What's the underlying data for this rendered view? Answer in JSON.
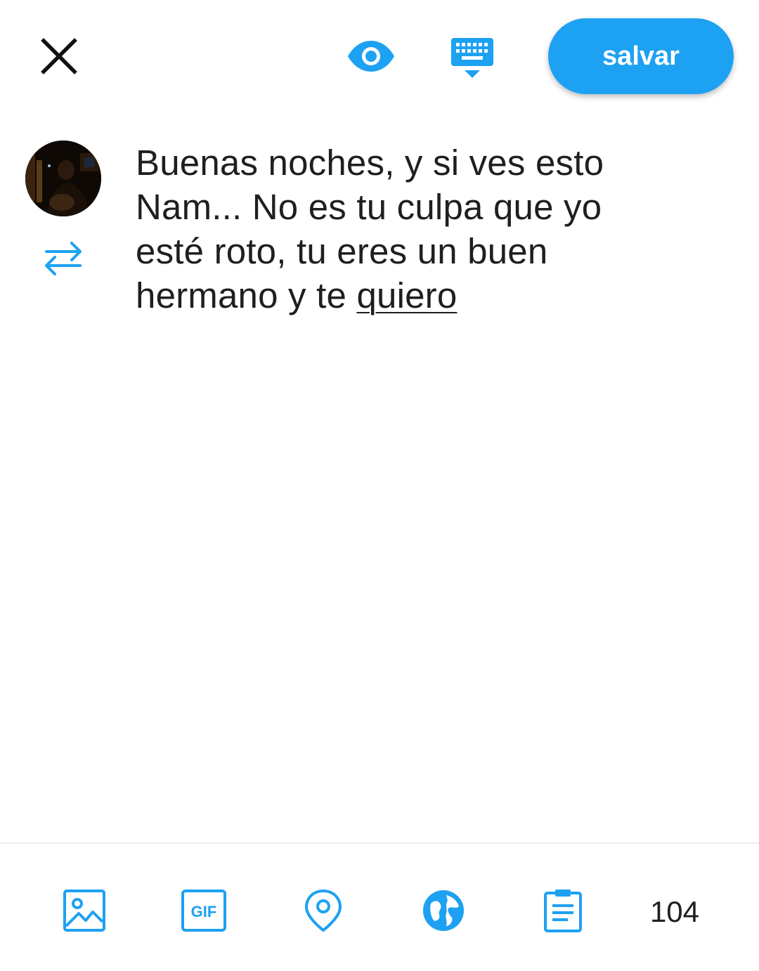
{
  "app": {
    "accent_color": "#1da1f2",
    "text_color": "#1f1f1f"
  },
  "topbar": {
    "close_icon": "close-icon",
    "preview_icon": "eye-icon",
    "keyboard_icon": "keyboard-hide-icon",
    "save_label": "salvar"
  },
  "composer": {
    "avatar_icon": "user-avatar",
    "swap_icon": "swap-arrows-icon",
    "text_part1": "Buenas noches, y si ves esto Nam... No es tu culpa que yo esté roto, tu eres un buen hermano y te ",
    "text_underlined": "quiero"
  },
  "toolbar": {
    "items": [
      {
        "icon": "image-icon"
      },
      {
        "icon": "gif-icon",
        "label": "GIF"
      },
      {
        "icon": "location-pin-icon"
      },
      {
        "icon": "globe-icon"
      },
      {
        "icon": "clipboard-icon"
      }
    ],
    "char_count": "104"
  }
}
